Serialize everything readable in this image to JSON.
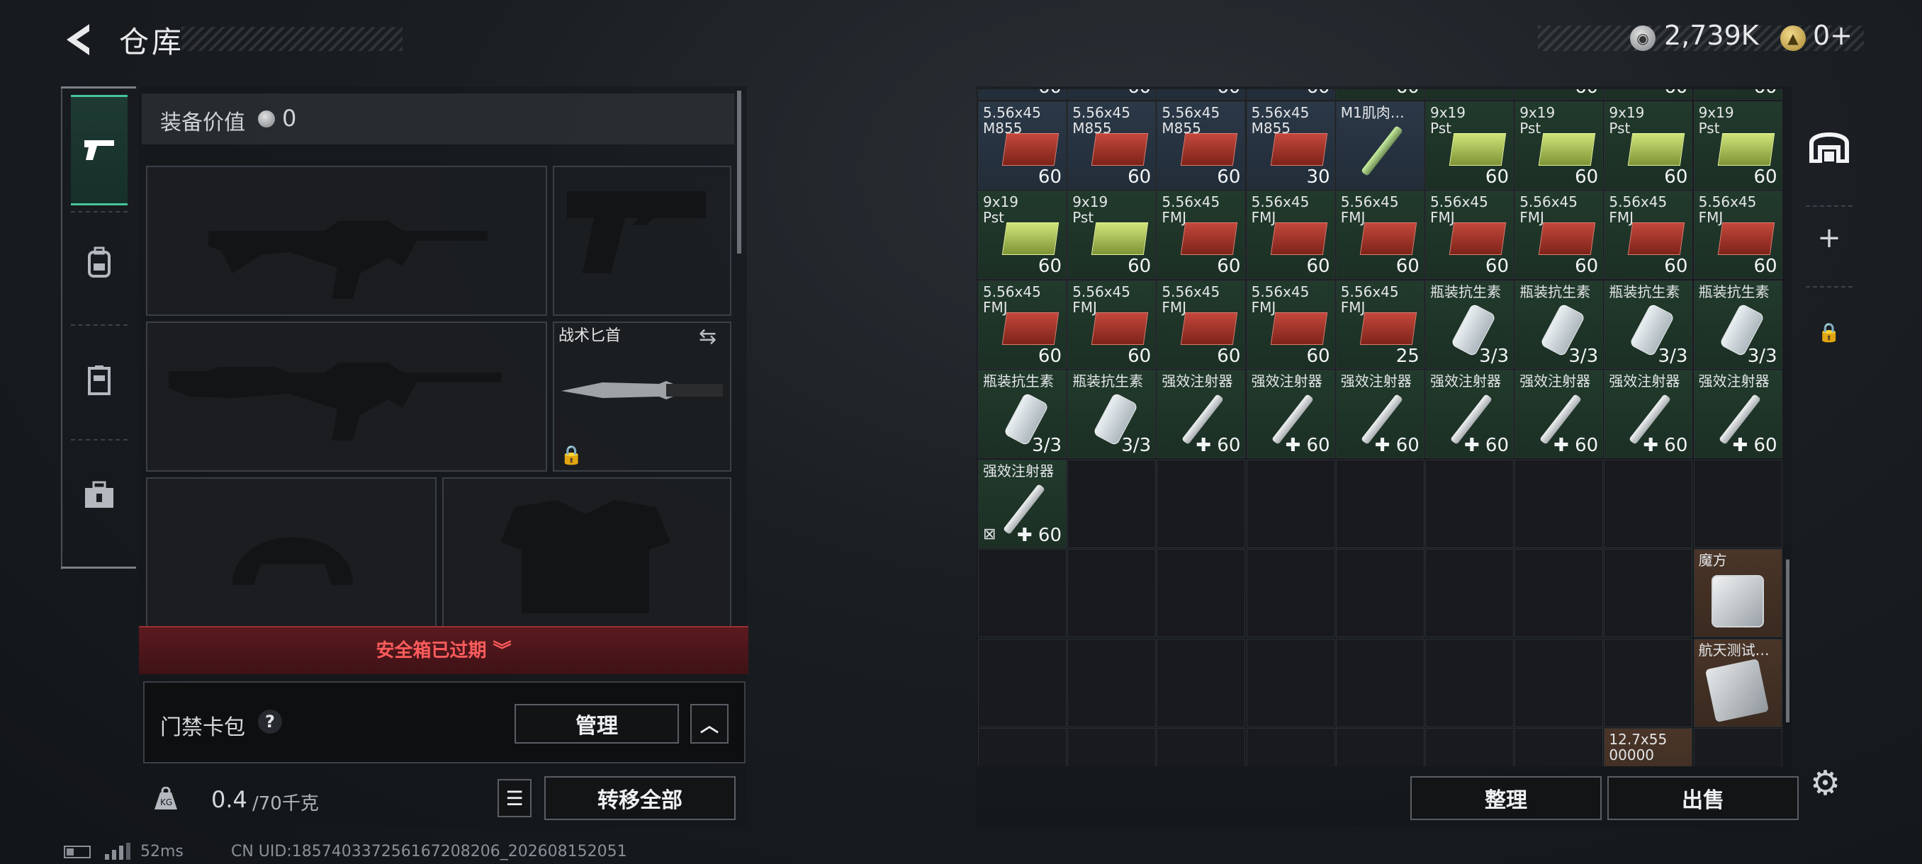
{
  "header": {
    "title": "仓库",
    "silver": "2,739K",
    "gold": "0+"
  },
  "nav": {
    "tabs": [
      {
        "icon": "pistol-icon",
        "active": true
      },
      {
        "icon": "backpack-icon",
        "active": false
      },
      {
        "icon": "vest-icon",
        "active": false
      },
      {
        "icon": "medkit-case-icon",
        "active": false
      }
    ]
  },
  "loadout": {
    "value_label": "装备价值",
    "value": "0",
    "knife_label": "战术匕首",
    "expired_label": "安全箱已过期",
    "card_label": "门禁卡包",
    "card_help": "?",
    "manage_label": "管理",
    "weight_value": "0.4",
    "weight_max": "/70千克",
    "transfer_label": "转移全部"
  },
  "grid": {
    "top_row_quantities": [
      "60",
      "60",
      "60",
      "60",
      "60",
      "",
      "60",
      "60",
      "60"
    ],
    "items": [
      {
        "name": "5.56x45\nM855",
        "qty": "60",
        "type": "ammo",
        "bg": "blue"
      },
      {
        "name": "5.56x45\nM855",
        "qty": "60",
        "type": "ammo",
        "bg": "blue"
      },
      {
        "name": "5.56x45\nM855",
        "qty": "60",
        "type": "ammo",
        "bg": "blue"
      },
      {
        "name": "5.56x45\nM855",
        "qty": "30",
        "type": "ammo",
        "bg": "blue"
      },
      {
        "name": "M1肌肉…",
        "qty": "",
        "type": "syringe-green",
        "bg": "blue"
      },
      {
        "name": "9x19\nPst",
        "qty": "60",
        "type": "ammo-green",
        "bg": "green"
      },
      {
        "name": "9x19\nPst",
        "qty": "60",
        "type": "ammo-green",
        "bg": "green"
      },
      {
        "name": "9x19\nPst",
        "qty": "60",
        "type": "ammo-green",
        "bg": "green"
      },
      {
        "name": "9x19\nPst",
        "qty": "60",
        "type": "ammo-green",
        "bg": "green"
      },
      {
        "name": "9x19\nPst",
        "qty": "60",
        "type": "ammo-green",
        "bg": "green"
      },
      {
        "name": "9x19\nPst",
        "qty": "60",
        "type": "ammo-green",
        "bg": "green"
      },
      {
        "name": "5.56x45\nFMJ",
        "qty": "60",
        "type": "ammo",
        "bg": "green"
      },
      {
        "name": "5.56x45\nFMJ",
        "qty": "60",
        "type": "ammo",
        "bg": "green"
      },
      {
        "name": "5.56x45\nFMJ",
        "qty": "60",
        "type": "ammo",
        "bg": "green"
      },
      {
        "name": "5.56x45\nFMJ",
        "qty": "60",
        "type": "ammo",
        "bg": "green"
      },
      {
        "name": "5.56x45\nFMJ",
        "qty": "60",
        "type": "ammo",
        "bg": "green"
      },
      {
        "name": "5.56x45\nFMJ",
        "qty": "60",
        "type": "ammo",
        "bg": "green"
      },
      {
        "name": "5.56x45\nFMJ",
        "qty": "60",
        "type": "ammo",
        "bg": "green"
      },
      {
        "name": "5.56x45\nFMJ",
        "qty": "60",
        "type": "ammo",
        "bg": "green"
      },
      {
        "name": "5.56x45\nFMJ",
        "qty": "60",
        "type": "ammo",
        "bg": "green"
      },
      {
        "name": "5.56x45\nFMJ",
        "qty": "60",
        "type": "ammo",
        "bg": "green"
      },
      {
        "name": "5.56x45\nFMJ",
        "qty": "60",
        "type": "ammo",
        "bg": "green"
      },
      {
        "name": "5.56x45\nFMJ",
        "qty": "25",
        "type": "ammo",
        "bg": "green"
      },
      {
        "name": "瓶装抗生素",
        "qty": "3/3",
        "type": "bottle",
        "bg": "green"
      },
      {
        "name": "瓶装抗生素",
        "qty": "3/3",
        "type": "bottle",
        "bg": "green"
      },
      {
        "name": "瓶装抗生素",
        "qty": "3/3",
        "type": "bottle",
        "bg": "green"
      },
      {
        "name": "瓶装抗生素",
        "qty": "3/3",
        "type": "bottle",
        "bg": "green"
      },
      {
        "name": "瓶装抗生素",
        "qty": "3/3",
        "type": "bottle",
        "bg": "green"
      },
      {
        "name": "瓶装抗生素",
        "qty": "3/3",
        "type": "bottle",
        "bg": "green"
      },
      {
        "name": "强效注射器",
        "qty": "✚ 60",
        "type": "syringe",
        "bg": "green"
      },
      {
        "name": "强效注射器",
        "qty": "✚ 60",
        "type": "syringe",
        "bg": "green"
      },
      {
        "name": "强效注射器",
        "qty": "✚ 60",
        "type": "syringe",
        "bg": "green"
      },
      {
        "name": "强效注射器",
        "qty": "✚ 60",
        "type": "syringe",
        "bg": "green"
      },
      {
        "name": "强效注射器",
        "qty": "✚ 60",
        "type": "syringe",
        "bg": "green"
      },
      {
        "name": "强效注射器",
        "qty": "✚ 60",
        "type": "syringe",
        "bg": "green"
      },
      {
        "name": "强效注射器",
        "qty": "✚ 60",
        "type": "syringe",
        "bg": "green"
      },
      {
        "name": "强效注射器",
        "qty": "✚ 60",
        "type": "syringe",
        "bg": "green",
        "no_trade": true
      }
    ],
    "side_items": [
      {
        "name": "魔方",
        "type": "cube",
        "bg": "brown"
      },
      {
        "name": "航天测试…",
        "type": "device",
        "bg": "brown"
      },
      {
        "name": "12.7x55\n00000",
        "type": "ammo",
        "bg": "brown"
      }
    ],
    "sort_label": "整理",
    "sell_label": "出售"
  },
  "footer": {
    "ping": "52ms",
    "uid": "CN UID:1857403372561672082​06_202608152051"
  }
}
